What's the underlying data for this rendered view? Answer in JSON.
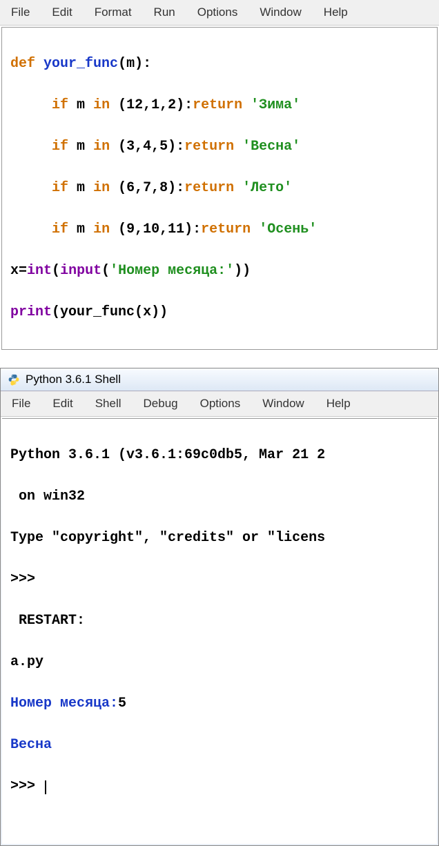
{
  "editor": {
    "menu": [
      "File",
      "Edit",
      "Format",
      "Run",
      "Options",
      "Window",
      "Help"
    ],
    "code": {
      "l1": {
        "def": "def",
        "fname": "your_func",
        "params": "(m):"
      },
      "l2": {
        "if": "if",
        "m": "m",
        "in": "in",
        "tuple": "(12,1,2)",
        "colon": ":",
        "ret": "return",
        "str": "'Зима'"
      },
      "l3": {
        "if": "if",
        "m": "m",
        "in": "in",
        "tuple": "(3,4,5)",
        "colon": ":",
        "ret": "return",
        "str": "'Весна'"
      },
      "l4": {
        "if": "if",
        "m": "m",
        "in": "in",
        "tuple": "(6,7,8)",
        "colon": ":",
        "ret": "return",
        "str": "'Лето'"
      },
      "l5": {
        "if": "if",
        "m": "m",
        "in": "in",
        "tuple": "(9,10,11)",
        "colon": ":",
        "ret": "return",
        "str": "'Осень'"
      },
      "l6": {
        "x": "x",
        "eq": "=",
        "int": "int",
        "open": "(",
        "input": "input",
        "argopen": "(",
        "prompt": "'Номер месяца:'",
        "close": "))"
      },
      "l7": {
        "print": "print",
        "open": "(",
        "fname": "your_func",
        "argopen": "(",
        "arg": "x",
        "close": "))"
      }
    }
  },
  "shell": {
    "title": "Python 3.6.1 Shell",
    "menu": [
      "File",
      "Edit",
      "Shell",
      "Debug",
      "Options",
      "Window",
      "Help"
    ],
    "version_line": "Python 3.6.1 (v3.6.1:69c0db5, Mar 21 2",
    "on_win": " on win32",
    "type_line": "Type \"copyright\", \"credits\" or \"licens",
    "prompt": ">>>",
    "restart": " RESTART:",
    "filename": "a.py",
    "input_prompt": "Номер месяца:",
    "input_value": "5",
    "output": "Весна"
  }
}
